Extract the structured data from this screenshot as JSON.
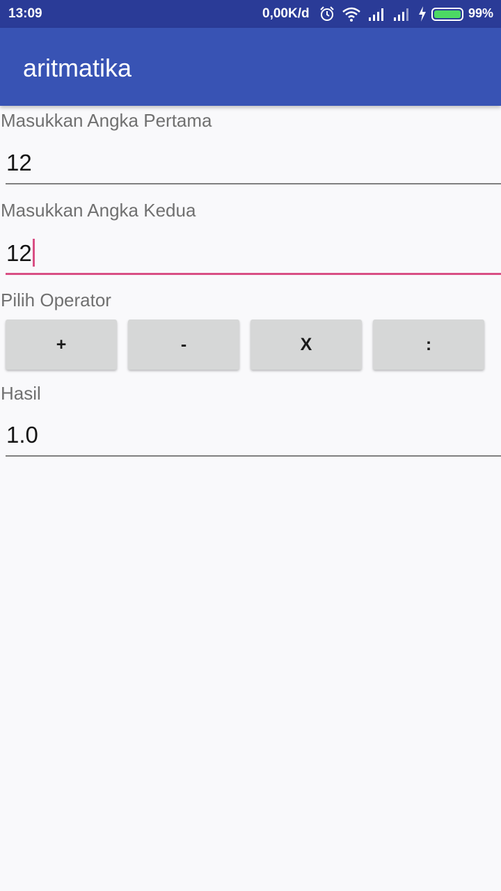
{
  "status_bar": {
    "time": "13:09",
    "network_speed": "0,00K/d",
    "battery_percent": "99%",
    "battery_level": 0.99,
    "icons": [
      "alarm-icon",
      "wifi-icon",
      "signal-icon",
      "signal-icon",
      "charging-icon",
      "battery-icon"
    ]
  },
  "app_bar": {
    "title": "aritmatika"
  },
  "form": {
    "first_label": "Masukkan Angka Pertama",
    "first_value": "12",
    "second_label": "Masukkan Angka Kedua",
    "second_value": "12",
    "operator_label": "Pilih Operator",
    "operators": [
      "+",
      "-",
      "X",
      ":"
    ],
    "result_label": "Hasil",
    "result_value": "1.0"
  },
  "colors": {
    "status_bar": "#2a3b97",
    "app_bar": "#3853b4",
    "accent": "#d94f84",
    "background": "#f9f9fb",
    "button": "#d6d7d7",
    "battery": "#4cd964"
  }
}
